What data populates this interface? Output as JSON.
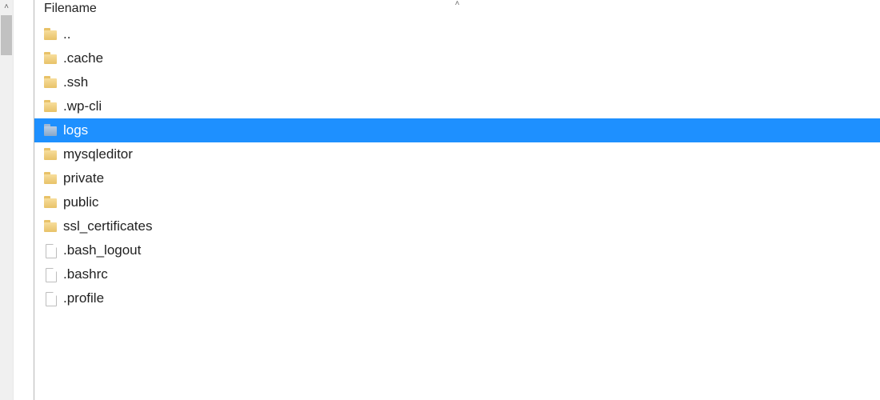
{
  "scrollbar": {
    "up_glyph": "˄"
  },
  "header": {
    "column_label": "Filename",
    "sort_caret": "˄"
  },
  "items": [
    {
      "name": "..",
      "type": "folder",
      "selected": false
    },
    {
      "name": ".cache",
      "type": "folder",
      "selected": false
    },
    {
      "name": ".ssh",
      "type": "folder",
      "selected": false
    },
    {
      "name": ".wp-cli",
      "type": "folder",
      "selected": false
    },
    {
      "name": "logs",
      "type": "folder",
      "selected": true
    },
    {
      "name": "mysqleditor",
      "type": "folder",
      "selected": false
    },
    {
      "name": "private",
      "type": "folder",
      "selected": false
    },
    {
      "name": "public",
      "type": "folder",
      "selected": false
    },
    {
      "name": "ssl_certificates",
      "type": "folder",
      "selected": false
    },
    {
      "name": ".bash_logout",
      "type": "file",
      "selected": false
    },
    {
      "name": ".bashrc",
      "type": "file",
      "selected": false
    },
    {
      "name": ".profile",
      "type": "file",
      "selected": false
    }
  ]
}
